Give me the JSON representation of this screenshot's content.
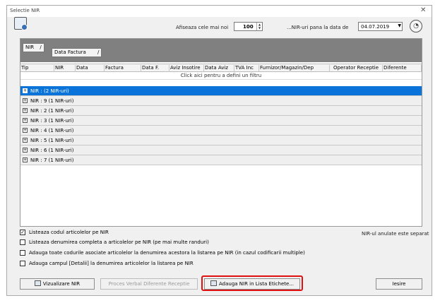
{
  "window": {
    "title": "Selectie NIR",
    "close_glyph": "✕"
  },
  "toolbar": {
    "show_last_label": "Afiseaza cele mai noi",
    "count_value": "100",
    "date_prefix_label": "...NIR-uri pana la data de",
    "date_value": "04.07.2019"
  },
  "grid": {
    "group_chips": [
      "NIR",
      "Data Factura"
    ],
    "chip_sort_glyph": "/",
    "columns": [
      "Tip",
      "NIR",
      "Data",
      "Factura",
      "Data F.",
      "Aviz Insotire",
      "Data Aviz",
      "TVA Inc",
      "Furnizor/Magazin/Dep",
      "Operator Receptie",
      "Diferente"
    ],
    "new_row_text": "Click aici pentru a defini un filtru",
    "groups": [
      {
        "label": "NIR : (2 NIR-uri)",
        "selected": true
      },
      {
        "label": "NIR : 9 (1 NIR-uri)",
        "selected": false
      },
      {
        "label": "NIR : 2 (1 NIR-uri)",
        "selected": false
      },
      {
        "label": "NIR : 3 (1 NIR-uri)",
        "selected": false
      },
      {
        "label": "NIR : 4 (1 NIR-uri)",
        "selected": false
      },
      {
        "label": "NIR : 5 (1 NIR-uri)",
        "selected": false
      },
      {
        "label": "NIR : 6 (1 NIR-uri)",
        "selected": false
      },
      {
        "label": "NIR : 7 (1 NIR-uri)",
        "selected": false
      }
    ],
    "expander_glyph": "+"
  },
  "options": [
    {
      "label": "Listeaza codul articolelor pe NIR",
      "checked": true
    },
    {
      "label": "Listeaza denumirea completa a articolelor pe NIR (pe mai multe randuri)",
      "checked": false
    },
    {
      "label": "Adauga toate codurile asociate articolelor la denumirea acestora la listarea pe NIR (in cazul codificarii multiple)",
      "checked": false
    },
    {
      "label": "Adauga campul [Detalii] la denumirea articolelor la listarea pe NIR",
      "checked": false
    }
  ],
  "status_note": "NIR-ul anulate este separat",
  "buttons": {
    "view_nir": "Vizualizare NIR",
    "reception_diff": "Proces Verbal Diferente Receptie",
    "add_to_labels": "Adauga NIR in Lista Etichete...",
    "exit": "Iesire"
  },
  "colors": {
    "selection": "#0a73d9",
    "highlight": "#e01010",
    "group_panel": "#808080"
  }
}
